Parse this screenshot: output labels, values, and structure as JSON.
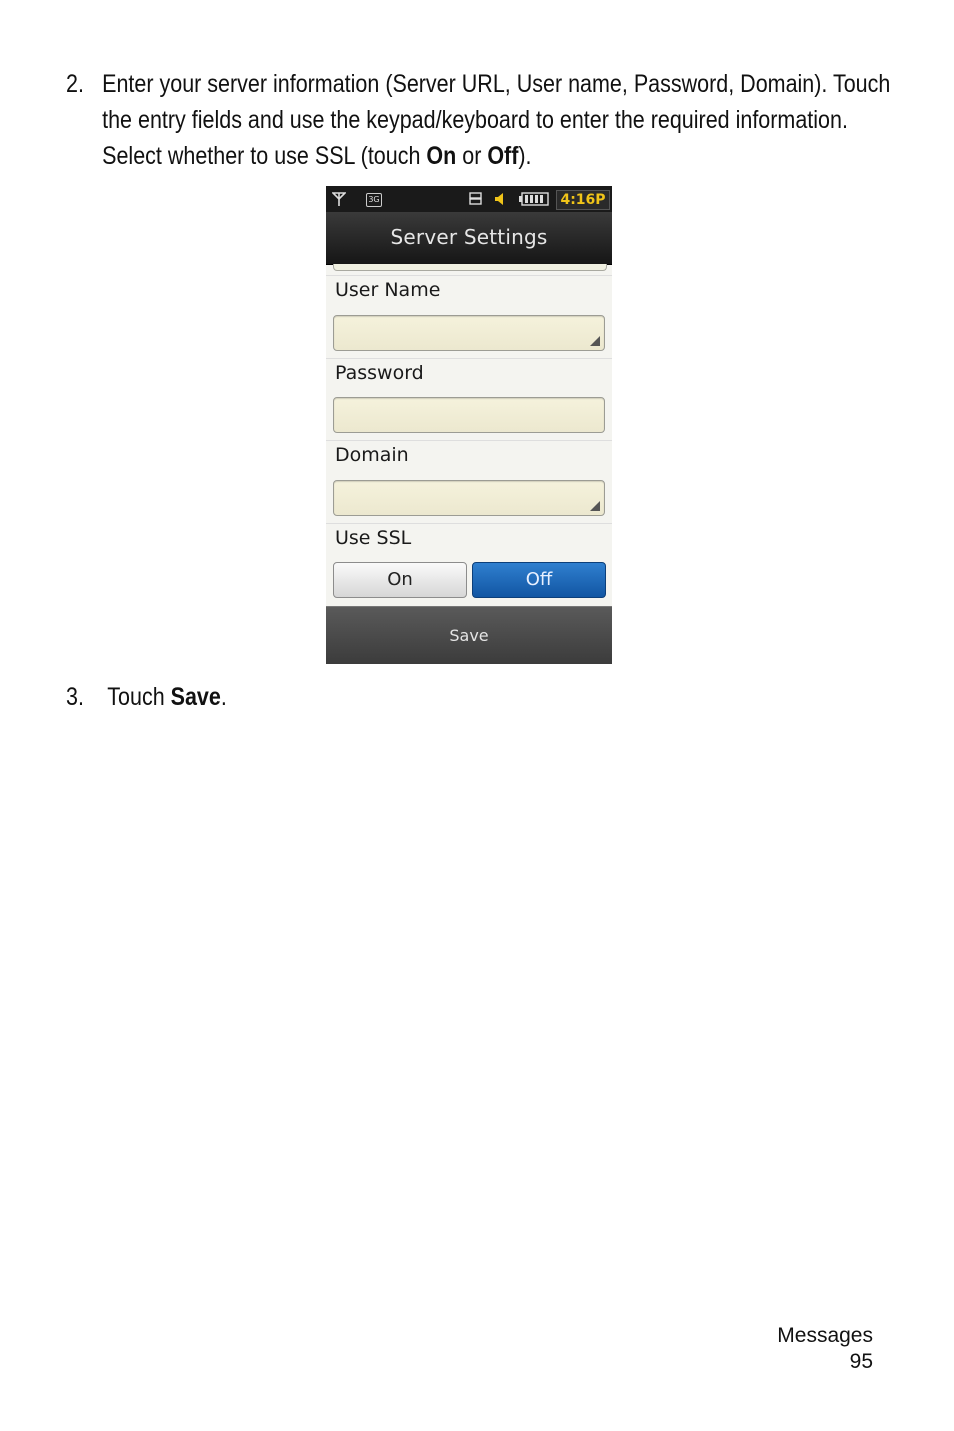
{
  "step2": {
    "number": "2.",
    "text_before": "Enter your server information (Server URL, User name, Password, Domain). Touch the entry fields and use the keypad/keyboard to enter the required information. Select whether to use SSL (touch ",
    "on": "On",
    "mid": " or ",
    "off": "Off",
    "end": ")."
  },
  "step3": {
    "number": "3.",
    "text_before": "Touch ",
    "bold": "Save",
    "end": "."
  },
  "phone": {
    "status_time": "4:16P",
    "status_network": "3G",
    "title": "Server Settings",
    "fields": {
      "user_name_label": "User Name",
      "password_label": "Password",
      "domain_label": "Domain",
      "ssl_label": "Use SSL"
    },
    "ssl_on": "On",
    "ssl_off": "Off",
    "ssl_selected": "Off",
    "save_label": "Save",
    "accent": "#1a5fae",
    "time_color": "#f0c419",
    "field_color": "#f1eed6"
  },
  "footer": {
    "section": "Messages",
    "page": "95"
  }
}
